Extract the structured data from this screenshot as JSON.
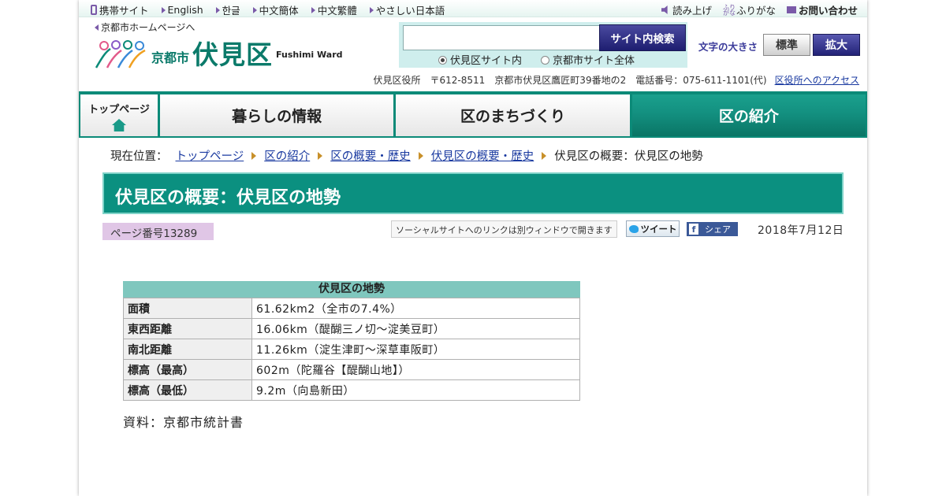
{
  "langbar": {
    "mobile": "携帯サイト",
    "english": "English",
    "korean": "한글",
    "chinese_simplified": "中文簡体",
    "chinese_traditional": "中文繁體",
    "easy_japanese": "やさしい日本語",
    "read_aloud": "読み上げ",
    "furigana": "ふりがな",
    "contact": "お問い合わせ",
    "furigana_icon_text": "ふりがな"
  },
  "header": {
    "home_link": "京都市ホームページへ",
    "logo_city": "京都市",
    "logo_ward": "伏見区",
    "logo_en": "Fushimi Ward",
    "search_placeholder": "",
    "search_button": "サイト内検索",
    "search_opt_ward": "伏見区サイト内",
    "search_opt_city": "京都市サイト全体",
    "fontsize_label": "文字の大きさ",
    "fontsize_normal": "標準",
    "fontsize_large": "拡大",
    "address": "伏見区役所　〒612-8511　京都市伏見区鷹匠町39番地の2　電話番号：075-611-1101(代)",
    "access_link": "区役所へのアクセス"
  },
  "nav": {
    "top": "トップページ",
    "items": [
      "暮らしの情報",
      "区のまちづくり",
      "区の紹介"
    ]
  },
  "breadcrumb": {
    "label": "現在位置：",
    "links": [
      "トップページ",
      "区の紹介",
      "区の概要・歴史",
      "伏見区の概要・歴史"
    ],
    "current": "伏見区の概要：伏見区の地勢"
  },
  "page": {
    "title": "伏見区の概要：伏見区の地勢",
    "page_number": "ページ番号13289",
    "social_note": "ソーシャルサイトへのリンクは別ウィンドウで開きます",
    "tweet": "ツイート",
    "share": "シェア",
    "date": "2018年7月12日"
  },
  "table": {
    "caption": "伏見区の地勢",
    "rows": [
      {
        "label": "面積",
        "value": "61.62km2（全市の7.4%）"
      },
      {
        "label": "東西距離",
        "value": "16.06km（醍醐三ノ切～淀美豆町）"
      },
      {
        "label": "南北距離",
        "value": "11.26km（淀生津町～深草車阪町）"
      },
      {
        "label": "標高（最高）",
        "value": "602m（陀羅谷【醍醐山地】）"
      },
      {
        "label": "標高（最低）",
        "value": "9.2m（向島新田）"
      }
    ]
  },
  "source": "資料：京都市統計書",
  "colors": {
    "accent": "#0b9080",
    "nav_border": "#0b8a78",
    "search_button": "#1e1e70",
    "page_number_bg": "#e0c6e6",
    "table_caption_bg": "#7fc7be"
  }
}
